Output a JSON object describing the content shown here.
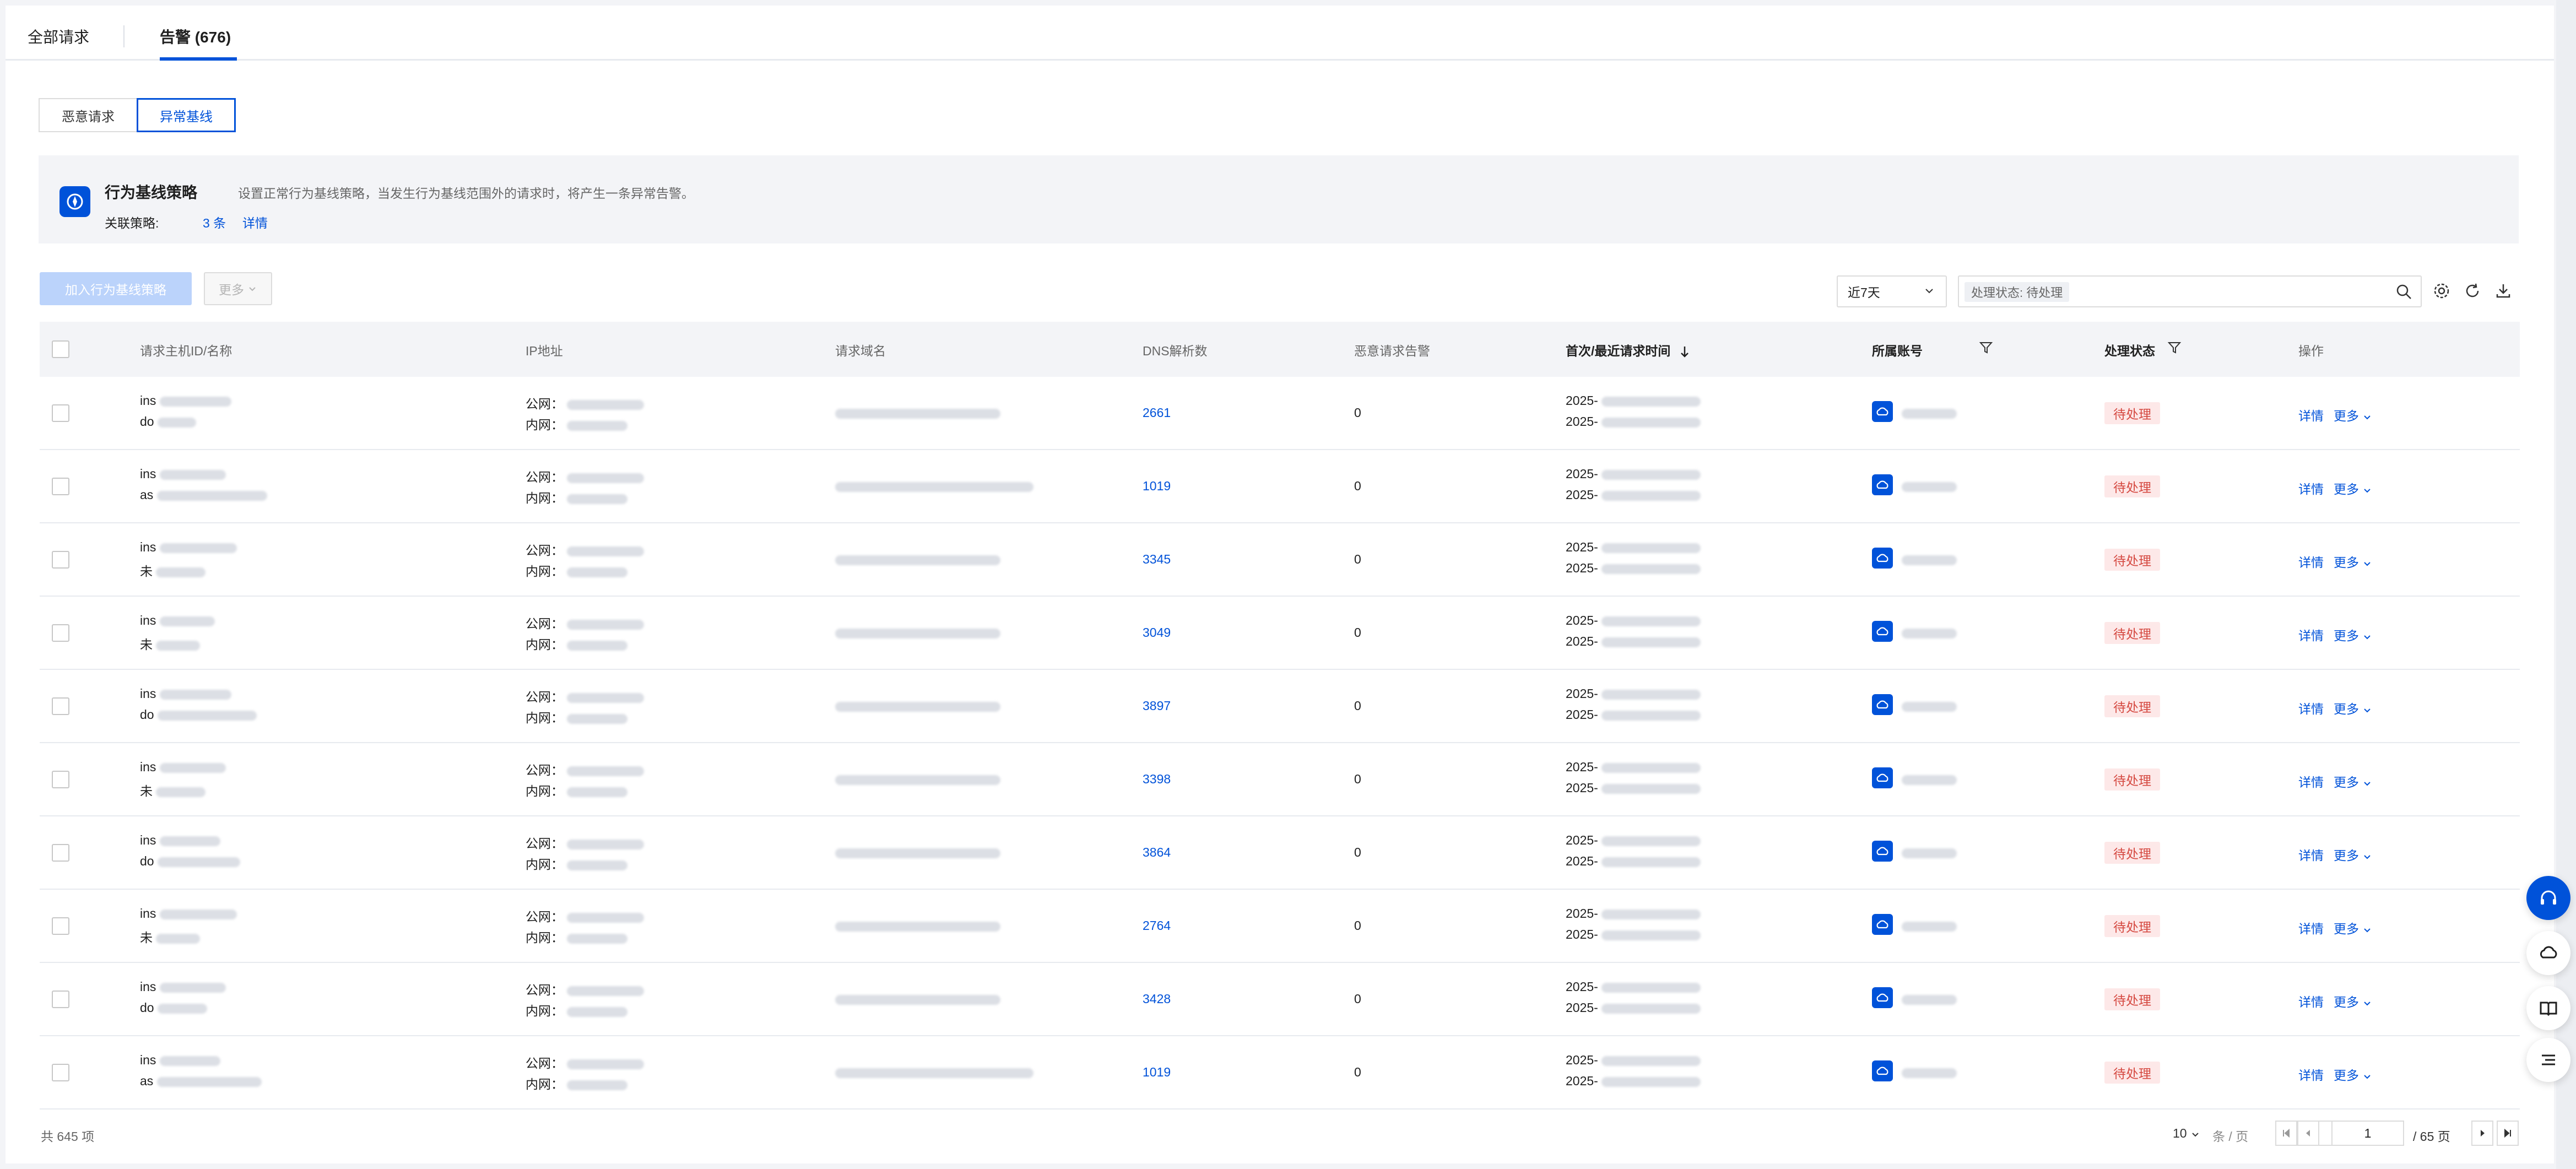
{
  "tabs": [
    {
      "label": "全部请求"
    },
    {
      "label": "告警 (676)"
    }
  ],
  "sub_tabs": [
    {
      "label": "恶意请求"
    },
    {
      "label": "异常基线"
    }
  ],
  "banner": {
    "title": "行为基线策略",
    "description": "设置正常行为基线策略，当发生行为基线范围外的请求时，将产生一条异常告警。",
    "related_label": "关联策略:",
    "related_count": "3 条",
    "detail_link": "详情"
  },
  "toolbar": {
    "add_button": "加入行为基线策略",
    "more_button": "更多",
    "time_range": "近7天",
    "filter_tag": "处理状态: 待处理"
  },
  "table": {
    "columns": [
      "请求主机ID/名称",
      "IP地址",
      "请求域名",
      "DNS解析数",
      "恶意请求告警",
      "首次/最近请求时间",
      "所属账号",
      "处理状态",
      "操作"
    ],
    "ip_public_label": "公网：",
    "ip_private_label": "内网：",
    "rows": [
      {
        "host_prefix_1": "ins",
        "host_prefix_2": "do",
        "dns_count": "2661",
        "malicious": "0",
        "time_1": "2025-",
        "time_2": "2025-",
        "status": "待处理",
        "detail": "详情",
        "more": "更多"
      },
      {
        "host_prefix_1": "ins",
        "host_prefix_2": "as",
        "dns_count": "1019",
        "malicious": "0",
        "time_1": "2025-",
        "time_2": "2025-",
        "status": "待处理",
        "detail": "详情",
        "more": "更多"
      },
      {
        "host_prefix_1": "ins",
        "host_prefix_2": "未",
        "dns_count": "3345",
        "malicious": "0",
        "time_1": "2025-",
        "time_2": "2025-",
        "status": "待处理",
        "detail": "详情",
        "more": "更多"
      },
      {
        "host_prefix_1": "ins",
        "host_prefix_2": "未",
        "dns_count": "3049",
        "malicious": "0",
        "time_1": "2025-",
        "time_2": "2025-",
        "status": "待处理",
        "detail": "详情",
        "more": "更多"
      },
      {
        "host_prefix_1": "ins",
        "host_prefix_2": "do",
        "dns_count": "3897",
        "malicious": "0",
        "time_1": "2025-",
        "time_2": "2025-",
        "status": "待处理",
        "detail": "详情",
        "more": "更多"
      },
      {
        "host_prefix_1": "ins",
        "host_prefix_2": "未",
        "dns_count": "3398",
        "malicious": "0",
        "time_1": "2025-",
        "time_2": "2025-",
        "status": "待处理",
        "detail": "详情",
        "more": "更多"
      },
      {
        "host_prefix_1": "ins",
        "host_prefix_2": "do",
        "dns_count": "3864",
        "malicious": "0",
        "time_1": "2025-",
        "time_2": "2025-",
        "status": "待处理",
        "detail": "详情",
        "more": "更多"
      },
      {
        "host_prefix_1": "ins",
        "host_prefix_2": "未",
        "dns_count": "2764",
        "malicious": "0",
        "time_1": "2025-",
        "time_2": "2025-",
        "status": "待处理",
        "detail": "详情",
        "more": "更多"
      },
      {
        "host_prefix_1": "ins",
        "host_prefix_2": "do",
        "dns_count": "3428",
        "malicious": "0",
        "time_1": "2025-",
        "time_2": "2025-",
        "status": "待处理",
        "detail": "详情",
        "more": "更多"
      },
      {
        "host_prefix_1": "ins",
        "host_prefix_2": "as",
        "dns_count": "1019",
        "malicious": "0",
        "time_1": "2025-",
        "time_2": "2025-",
        "status": "待处理",
        "detail": "详情",
        "more": "更多"
      }
    ]
  },
  "footer": {
    "total": "共 645 项",
    "page_size": "10",
    "page_size_unit": "条 / 页",
    "current_page": "1",
    "total_pages": "/ 65 页"
  },
  "colors": {
    "accent": "#0052d9",
    "status_pending_bg": "#fde8e8",
    "status_pending_text": "#d54941"
  },
  "icons": [
    "strategy-icon",
    "chevron-down-icon",
    "search-icon",
    "settings-icon",
    "refresh-icon",
    "download-icon",
    "filter-icon",
    "sort-down-icon",
    "cloud-account-icon",
    "first-page-icon",
    "prev-page-icon",
    "next-page-icon",
    "last-page-icon",
    "headset-icon",
    "cloud-chat-icon",
    "book-icon",
    "list-icon"
  ]
}
